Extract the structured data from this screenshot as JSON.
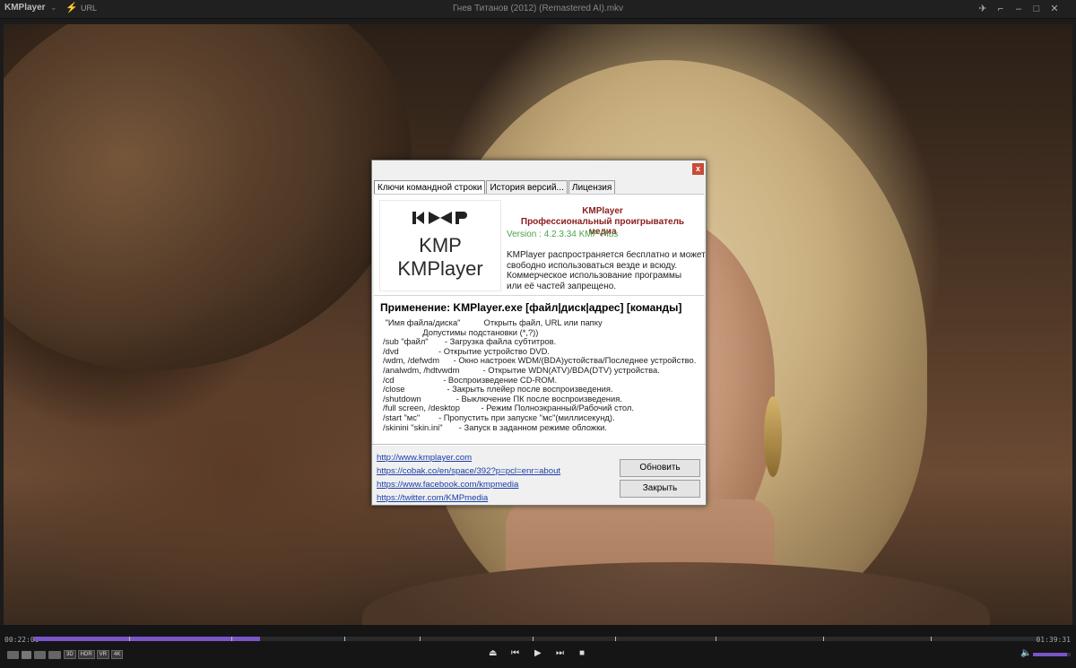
{
  "titlebar": {
    "app_logo": "KMPlayer",
    "logo_caret": "⌄",
    "url_label": "URL",
    "window_title": "Гнев Титанов (2012) (Remastered AI).mkv",
    "icons": [
      "pin-icon",
      "minimize-icon",
      "maximize-icon",
      "close-icon"
    ]
  },
  "dialog": {
    "close_glyph": "x",
    "tabs": [
      "Ключи командной строки",
      "История версий...",
      "Лицензия"
    ],
    "logo": {
      "kmp": "KMP",
      "kmplayer": "KMPlayer"
    },
    "app_name": "KMPlayer",
    "app_subtitle": "Профессиональный проигрыватель медиа",
    "version": "Version : 4.2.3.34 KMP Plus",
    "description": [
      "KMPlayer распространяется бесплатно и может",
      "свободно использоваться везде и всюду.",
      "Коммерческое использование программы",
      "или её частей запрещено."
    ],
    "usage": "Применение: KMPlayer.exe   [файл|диск|адрес] [команды]",
    "commands": [
      " \"Имя файла/диска\"          Открыть файл, URL или папку",
      "                 Допустимы подстановки (*,?))",
      "/sub \"файл\"       - Загрузка файла субтитров.",
      "/dvd                 - Открытие устройство DVD.",
      "/wdm, /defwdm      - Окно настроек WDM/(BDA)устойства/Последнее устройство.",
      "/analwdm, /hdtvwdm          - Открытие WDN(ATV)/BDA(DTV) устройства.",
      "/cd                     - Воспроизведение CD-ROM.",
      "/close                  - Закрыть плейер после воспроизведения.",
      "/shutdown               - Выключение ПК после воспроизведения.",
      "/full screen, /desktop         - Режим Полноэкранный/Рабочий стол.",
      "/start \"мс\"        - Пропустить при запуске \"мс\"(миллисекунд).",
      "/skinini \"skin.ini\"       - Запуск в заданном режиме обложки."
    ],
    "links": [
      "http://www.kmplayer.com",
      "https://cobak.co/en/space/392?p=pcl=enr=about",
      "https://www.facebook.com/kmpmedia",
      "https://twitter.com/KMPmedia"
    ],
    "buttons": {
      "update": "Обновить",
      "close": "Закрыть"
    }
  },
  "controls": {
    "time_elapsed": "00:22:00",
    "time_total": "01:39:31",
    "progress_fraction": 0.225,
    "volume_fraction": 0.9,
    "badges": [
      "3D",
      "HDR",
      "VR",
      "4K"
    ],
    "accent_color": "#7a55c8"
  }
}
